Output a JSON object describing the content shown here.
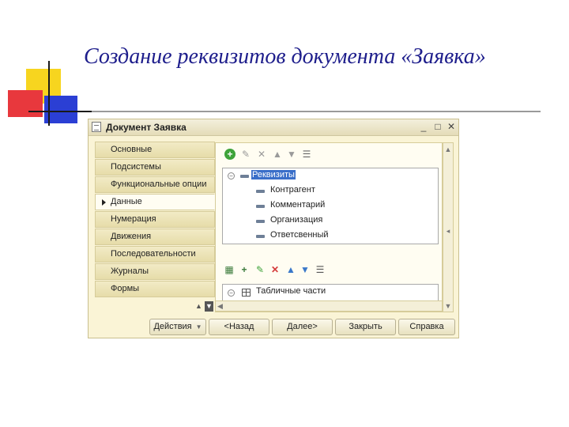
{
  "slide": {
    "title": "Создание реквизитов документа «Заявка»"
  },
  "window": {
    "title": "Документ Заявка",
    "controls": [
      "_",
      "□",
      "✕"
    ]
  },
  "tabs": [
    {
      "label": "Основные",
      "active": false
    },
    {
      "label": "Подсистемы",
      "active": false
    },
    {
      "label": "Функциональные опции",
      "active": false
    },
    {
      "label": "Данные",
      "active": true
    },
    {
      "label": "Нумерация",
      "active": false
    },
    {
      "label": "Движения",
      "active": false
    },
    {
      "label": "Последовательности",
      "active": false
    },
    {
      "label": "Журналы",
      "active": false
    },
    {
      "label": "Формы",
      "active": false
    }
  ],
  "attributes_tree": {
    "root": "Реквизиты",
    "items": [
      "Контрагент",
      "Комментарий",
      "Организация",
      "Ответсвенный"
    ]
  },
  "tabular_tree": {
    "root": "Табличные части"
  },
  "buttons": {
    "actions": "Действия",
    "back": "<Назад",
    "next": "Далее>",
    "close": "Закрыть",
    "help": "Справка"
  },
  "colors": {
    "title": "#1e1e8c",
    "window_bg": "#faf4d6",
    "selection": "#3a6fc9"
  }
}
